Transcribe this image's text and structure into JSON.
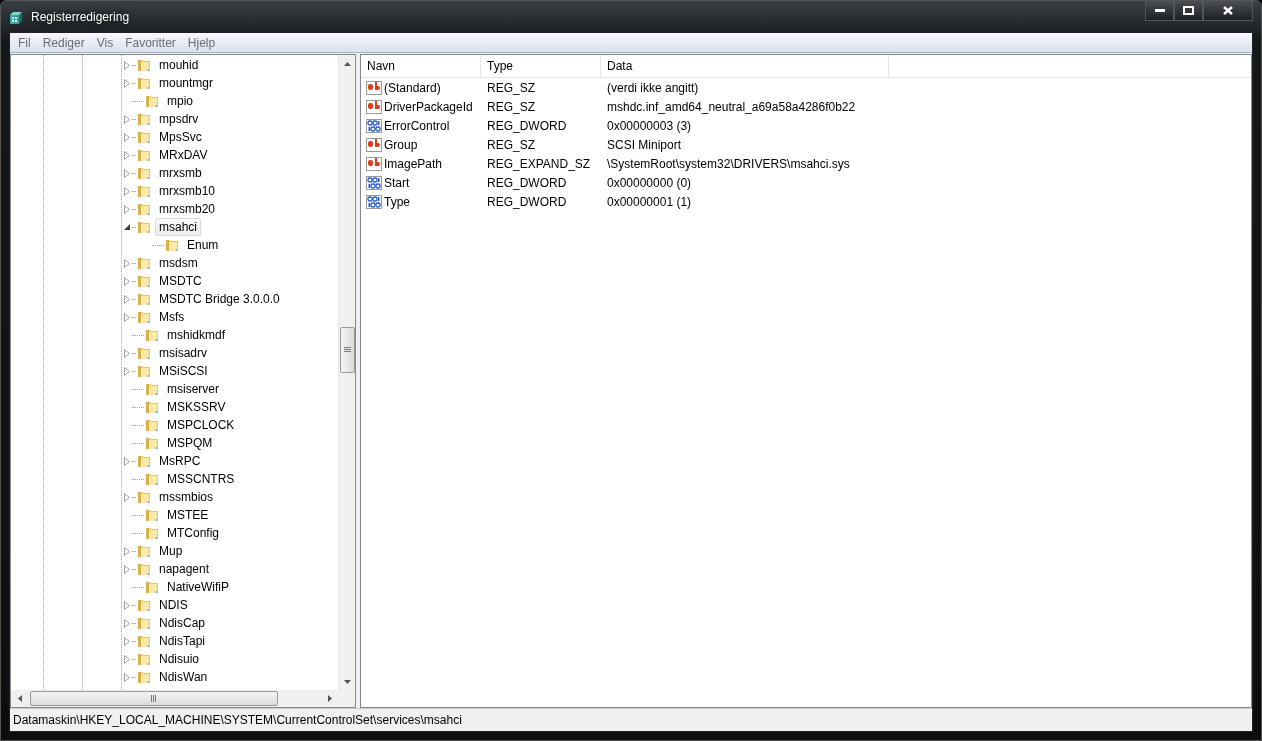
{
  "window": {
    "title": "Registerredigering"
  },
  "menu": [
    "Fil",
    "Rediger",
    "Vis",
    "Favoritter",
    "Hjelp"
  ],
  "tree": [
    {
      "kind": "branch",
      "label": "mouhid",
      "expanded": false,
      "selected": false
    },
    {
      "kind": "branch",
      "label": "mountmgr",
      "expanded": false,
      "selected": false
    },
    {
      "kind": "leaf",
      "label": "mpio",
      "selected": false
    },
    {
      "kind": "branch",
      "label": "mpsdrv",
      "expanded": false,
      "selected": false
    },
    {
      "kind": "branch",
      "label": "MpsSvc",
      "expanded": false,
      "selected": false
    },
    {
      "kind": "branch",
      "label": "MRxDAV",
      "expanded": false,
      "selected": false
    },
    {
      "kind": "branch",
      "label": "mrxsmb",
      "expanded": false,
      "selected": false
    },
    {
      "kind": "branch",
      "label": "mrxsmb10",
      "expanded": false,
      "selected": false
    },
    {
      "kind": "branch",
      "label": "mrxsmb20",
      "expanded": false,
      "selected": false
    },
    {
      "kind": "branch",
      "label": "msahci",
      "expanded": true,
      "selected": true,
      "children": [
        {
          "kind": "leaf",
          "label": "Enum",
          "selected": false
        }
      ]
    },
    {
      "kind": "branch",
      "label": "msdsm",
      "expanded": false,
      "selected": false
    },
    {
      "kind": "branch",
      "label": "MSDTC",
      "expanded": false,
      "selected": false
    },
    {
      "kind": "branch",
      "label": "MSDTC Bridge 3.0.0.0",
      "expanded": false,
      "selected": false
    },
    {
      "kind": "branch",
      "label": "Msfs",
      "expanded": false,
      "selected": false
    },
    {
      "kind": "leaf",
      "label": "mshidkmdf",
      "selected": false
    },
    {
      "kind": "branch",
      "label": "msisadrv",
      "expanded": false,
      "selected": false
    },
    {
      "kind": "branch",
      "label": "MSiSCSI",
      "expanded": false,
      "selected": false
    },
    {
      "kind": "leaf",
      "label": "msiserver",
      "selected": false
    },
    {
      "kind": "leaf",
      "label": "MSKSSRV",
      "selected": false
    },
    {
      "kind": "leaf",
      "label": "MSPCLOCK",
      "selected": false
    },
    {
      "kind": "leaf",
      "label": "MSPQM",
      "selected": false
    },
    {
      "kind": "branch",
      "label": "MsRPC",
      "expanded": false,
      "selected": false
    },
    {
      "kind": "leaf",
      "label": "MSSCNTRS",
      "selected": false
    },
    {
      "kind": "branch",
      "label": "mssmbios",
      "expanded": false,
      "selected": false
    },
    {
      "kind": "leaf",
      "label": "MSTEE",
      "selected": false
    },
    {
      "kind": "leaf",
      "label": "MTConfig",
      "selected": false
    },
    {
      "kind": "branch",
      "label": "Mup",
      "expanded": false,
      "selected": false
    },
    {
      "kind": "branch",
      "label": "napagent",
      "expanded": false,
      "selected": false
    },
    {
      "kind": "leaf",
      "label": "NativeWifiP",
      "selected": false
    },
    {
      "kind": "branch",
      "label": "NDIS",
      "expanded": false,
      "selected": false
    },
    {
      "kind": "branch",
      "label": "NdisCap",
      "expanded": false,
      "selected": false
    },
    {
      "kind": "branch",
      "label": "NdisTapi",
      "expanded": false,
      "selected": false
    },
    {
      "kind": "branch",
      "label": "Ndisuio",
      "expanded": false,
      "selected": false
    },
    {
      "kind": "branch",
      "label": "NdisWan",
      "expanded": false,
      "selected": false
    }
  ],
  "table": {
    "columns": [
      "Navn",
      "Type",
      "Data"
    ],
    "rows": [
      {
        "kind": "string",
        "name": "(Standard)",
        "type": "REG_SZ",
        "data": "(verdi ikke angitt)"
      },
      {
        "kind": "string",
        "name": "DriverPackageId",
        "type": "REG_SZ",
        "data": "mshdc.inf_amd64_neutral_a69a58a4286f0b22"
      },
      {
        "kind": "binary",
        "name": "ErrorControl",
        "type": "REG_DWORD",
        "data": "0x00000003 (3)"
      },
      {
        "kind": "string",
        "name": "Group",
        "type": "REG_SZ",
        "data": "SCSI Miniport"
      },
      {
        "kind": "string",
        "name": "ImagePath",
        "type": "REG_EXPAND_SZ",
        "data": "\\SystemRoot\\system32\\DRIVERS\\msahci.sys"
      },
      {
        "kind": "binary",
        "name": "Start",
        "type": "REG_DWORD",
        "data": "0x00000000 (0)"
      },
      {
        "kind": "binary",
        "name": "Type",
        "type": "REG_DWORD",
        "data": "0x00000001 (1)"
      }
    ]
  },
  "status_bar": "Datamaskin\\HKEY_LOCAL_MACHINE\\SYSTEM\\CurrentControlSet\\services\\msahci"
}
